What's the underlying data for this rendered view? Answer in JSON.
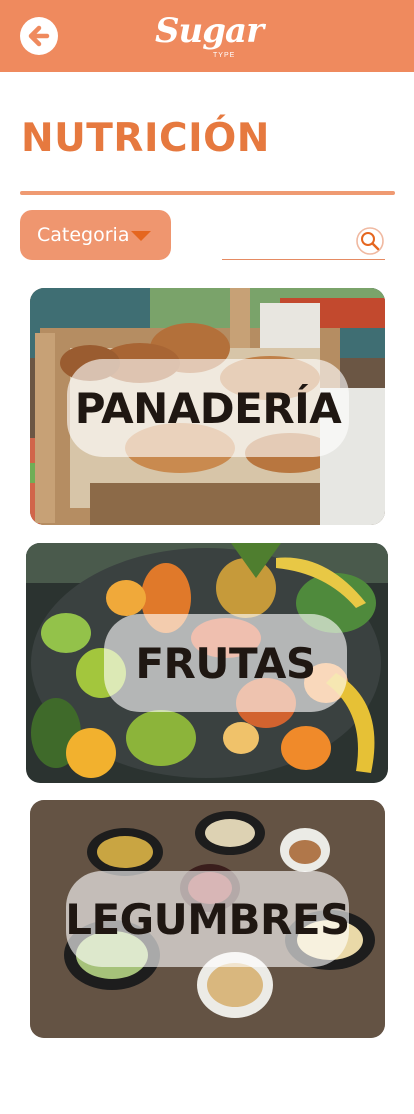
{
  "header": {
    "logo_main": "Sugar",
    "logo_sub": "TYPE",
    "back_icon": "arrow-left-icon"
  },
  "page": {
    "title": "NUTRICIÓN"
  },
  "filters": {
    "category_label": "Categoria",
    "search_placeholder": "",
    "search_value": ""
  },
  "categories": [
    {
      "label": "PANADERÍA"
    },
    {
      "label": "FRUTAS"
    },
    {
      "label": "LEGUMBRES"
    }
  ],
  "colors": {
    "header": "#ef8a5e",
    "accent": "#e6793f",
    "button": "#ef966f",
    "caret": "#e5661f"
  }
}
